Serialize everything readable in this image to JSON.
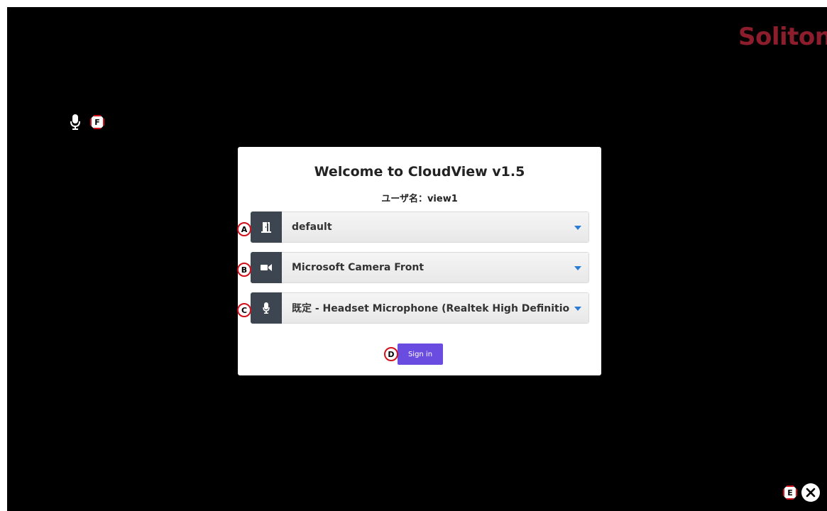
{
  "logo": {
    "text": "Soliton",
    "color": "#8b1d2c"
  },
  "dialog": {
    "title": "Welcome to CloudView v1.5",
    "username_line": "ユーザ名：view1",
    "selects": [
      {
        "icon": "door-icon",
        "value": "default",
        "badge": "A"
      },
      {
        "icon": "video-camera-icon",
        "value": "Microsoft Camera Front",
        "badge": "B"
      },
      {
        "icon": "microphone-icon",
        "value": "既定 - Headset Microphone (Realtek High Definitio",
        "badge": "C"
      }
    ],
    "signin": {
      "label": "Sign in",
      "badge": "D",
      "color": "#6a4de0"
    }
  },
  "close": {
    "badge": "E",
    "icon": "close-icon"
  },
  "mic_toggle": {
    "badge": "F",
    "icon": "microphone-icon"
  },
  "colors": {
    "background": "#000000",
    "icon_panel": "#3c4550",
    "badge_border": "#d2101c",
    "caret": "#2a7bd6"
  }
}
